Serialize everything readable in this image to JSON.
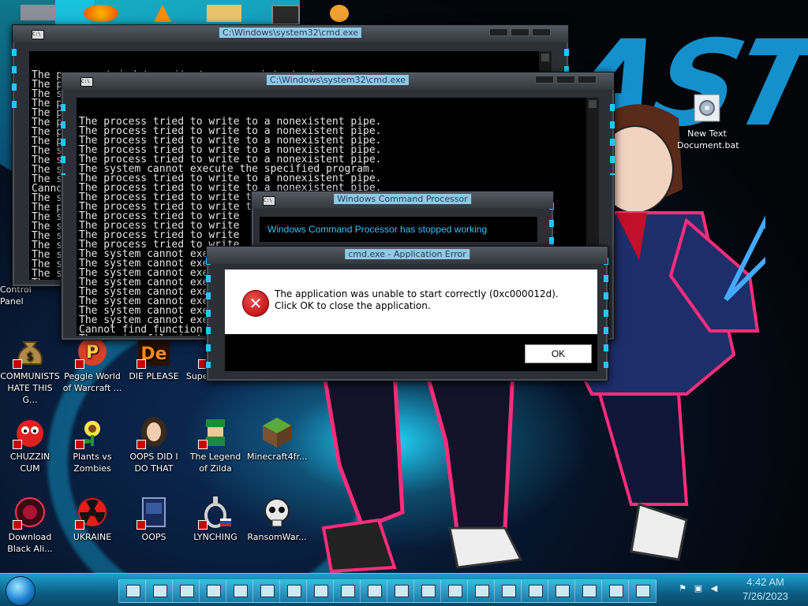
{
  "desktop": {
    "icons_top_row": [
      "",
      "",
      "",
      "",
      "",
      ""
    ],
    "icons": [
      {
        "label": "COMMUNISTS HATE THIS G...",
        "icon": "money-bag-icon"
      },
      {
        "label": "Peggle World of Warcraft ...",
        "icon": "peggle-icon"
      },
      {
        "label": "DIE PLEASE",
        "icon": "de-app-icon"
      },
      {
        "label": "Super Hexa...",
        "icon": "app-icon"
      },
      {
        "label": "CHUZZIN CUM",
        "icon": "chuzzle-icon"
      },
      {
        "label": "Plants vs Zombies",
        "icon": "plants-icon"
      },
      {
        "label": "OOPS DID I DO THAT",
        "icon": "portrait-icon"
      },
      {
        "label": "The Legend of Zilda",
        "icon": "zelda-icon"
      },
      {
        "label": "Minecraft4fr...",
        "icon": "minecraft-icon"
      },
      {
        "label": "Download Black Ali...",
        "icon": "orb-icon"
      },
      {
        "label": "UKRAINE",
        "icon": "radiation-icon"
      },
      {
        "label": "OOPS",
        "icon": "book-icon"
      },
      {
        "label": "LYNCHING",
        "icon": "noose-icon"
      },
      {
        "label": "RansomWar...",
        "icon": "skull-icon"
      },
      {
        "label": "New Text Document.bat",
        "icon": "batch-file-icon"
      },
      {
        "label": "Control Panel",
        "icon": "control-panel-icon"
      }
    ]
  },
  "cmd1": {
    "title": "C:\\Windows\\system32\\cmd.exe",
    "lines": [
      "The process tried to write to a nonexistent pipe.",
      "The process tried to write to a nonexistent pipe.",
      "The s",
      "The p",
      "The p",
      "The p",
      "The p",
      "The p",
      "The s",
      "The s",
      "The s",
      "The s",
      "Canno",
      "The s",
      "The p",
      "The s",
      "The s",
      "The s",
      "The s",
      "The s",
      "The s",
      "The s",
      "The s"
    ]
  },
  "cmd2": {
    "title": "C:\\Windows\\system32\\cmd.exe",
    "lines": [
      "The process tried to write to a nonexistent pipe.",
      "The process tried to write to a nonexistent pipe.",
      "The process tried to write to a nonexistent pipe.",
      "The process tried to write to a nonexistent pipe.",
      "The process tried to write to a nonexistent pipe.",
      "The system cannot execute the specified program.",
      "The process tried to write to a nonexistent pipe.",
      "The process tried to write to a nonexistent pipe.",
      "The process tried to write to a nonexistent pipe.",
      "The process tried to write to a nonexistent pipe.",
      "The process tried to write",
      "The process tried to write",
      "The process tried to write",
      "The process tried to write",
      "The system cannot execute",
      "The system cannot exe",
      "The system cannot exe",
      "The system cannot exe",
      "The system cannot exe",
      "The system cannot exe",
      "The system cannot exe",
      "The system cannot exe",
      "Cannot find function",
      "The paging file is to"
    ]
  },
  "stopped_dialog": {
    "title": "Windows Command Processor",
    "message": "Windows Command Processor has stopped working"
  },
  "error_dialog": {
    "title": "cmd.exe - Application Error",
    "message": "The application was unable to start correctly (0xc000012d). Click OK to close the application.",
    "ok_label": "OK"
  },
  "taskbar": {
    "time": "4:42 AM",
    "date": "7/26/2023",
    "item_count_icons": [
      "explorer-icon",
      "explorer-icon",
      "explorer-icon",
      "explorer-icon",
      "explorer-icon",
      "explorer-icon",
      "explorer-icon",
      "explorer-icon",
      "explorer-icon",
      "explorer-icon",
      "explorer-icon",
      "explorer-icon",
      "explorer-icon",
      "explorer-icon",
      "explorer-icon",
      "explorer-icon",
      "explorer-icon",
      "explorer-icon",
      "explorer-icon",
      "explorer-icon"
    ]
  },
  "colors": {
    "accent": "#1ec8ff",
    "dialog_text": "#39c2ff"
  }
}
